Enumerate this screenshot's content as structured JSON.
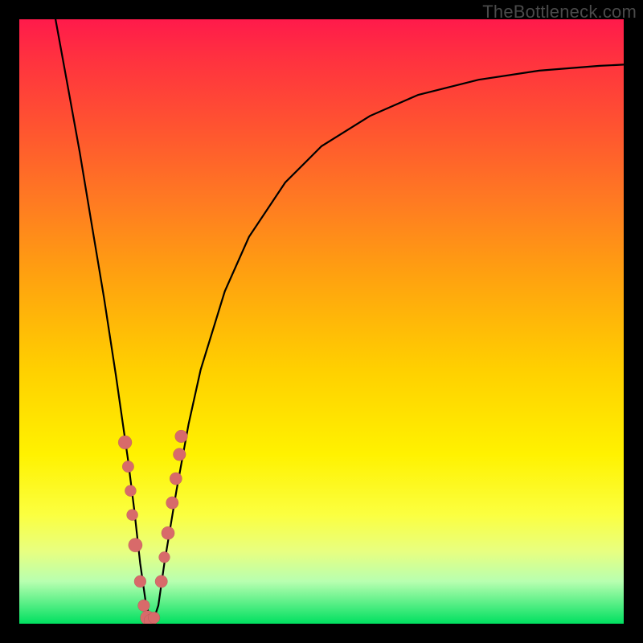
{
  "watermark": "TheBottleneck.com",
  "chart_data": {
    "type": "line",
    "title": "",
    "xlabel": "",
    "ylabel": "",
    "xlim": [
      0,
      100
    ],
    "ylim": [
      0,
      100
    ],
    "series": [
      {
        "name": "bottleneck-curve",
        "x": [
          6,
          8,
          10,
          12,
          14,
          16,
          18,
          19,
          20,
          21,
          22,
          23,
          24,
          26,
          28,
          30,
          34,
          38,
          44,
          50,
          58,
          66,
          76,
          86,
          96,
          100
        ],
        "y": [
          100,
          89,
          78,
          66,
          54,
          41,
          27,
          19,
          10,
          3,
          0,
          3,
          10,
          22,
          33,
          42,
          55,
          64,
          73,
          79,
          84,
          87.5,
          90,
          91.5,
          92.3,
          92.5
        ]
      }
    ],
    "points": {
      "name": "highlighted-cluster",
      "x": [
        17.5,
        18.0,
        18.4,
        18.7,
        19.2,
        20.0,
        20.6,
        21.2,
        21.7,
        22.3,
        23.5,
        24.0,
        24.6,
        25.3,
        25.9,
        26.5,
        26.8
      ],
      "y": [
        30,
        26,
        22,
        18,
        13,
        7,
        3,
        1,
        0.5,
        1,
        7,
        11,
        15,
        20,
        24,
        28,
        31
      ]
    }
  }
}
